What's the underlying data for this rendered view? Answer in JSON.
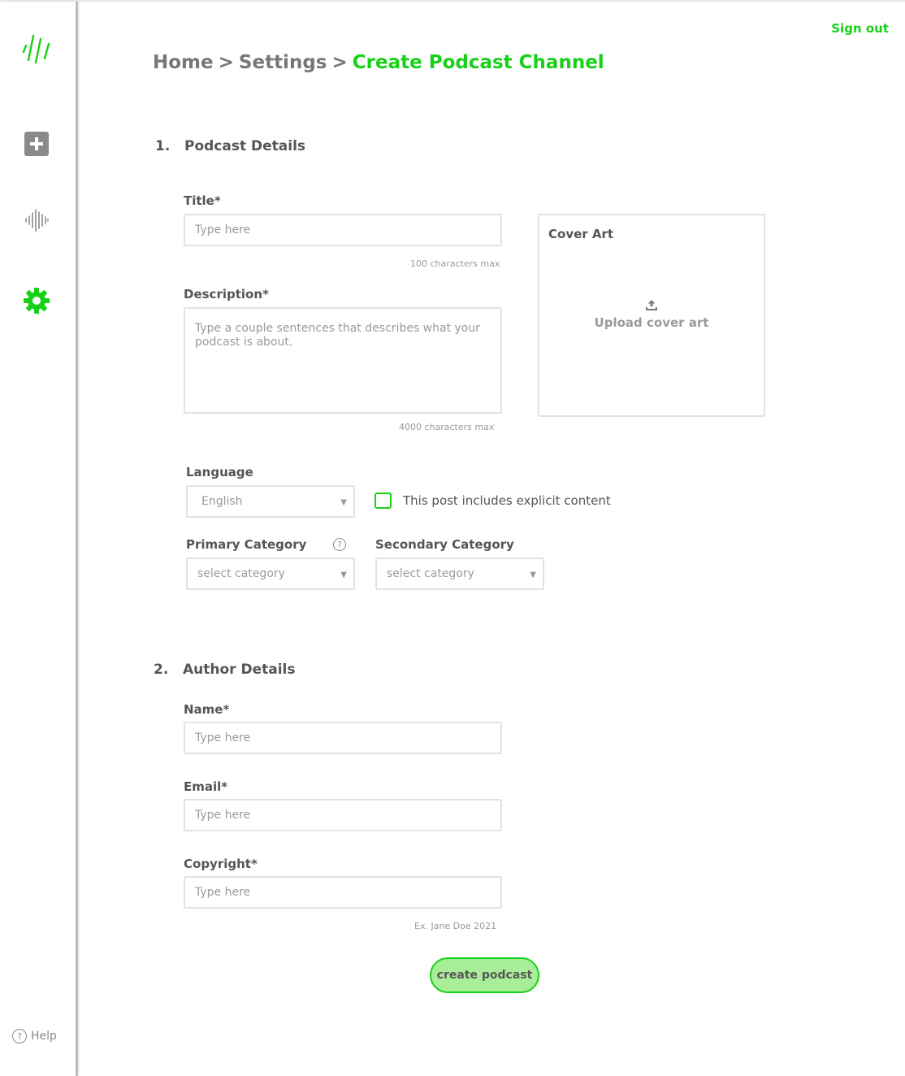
{
  "header": {
    "sign_out": "Sign out",
    "breadcrumb": {
      "home": "Home",
      "settings": "Settings",
      "separator": ">",
      "current": "Create Podcast Channel"
    }
  },
  "sidebar": {
    "icons": [
      "logo-icon",
      "plus-icon",
      "waveform-icon",
      "gear-icon"
    ],
    "help_label": "Help"
  },
  "colors": {
    "accent": "#17d117",
    "accent_light": "#a8ee99",
    "text": "#555555",
    "muted": "#9a9a9a",
    "border": "#e2e2e2"
  },
  "podcast_details": {
    "number": "1.",
    "title": "Podcast Details",
    "title_field": {
      "label": "Title*",
      "placeholder": "Type here",
      "hint": "100 characters max"
    },
    "description_field": {
      "label": "Description*",
      "placeholder": "Type a couple sentences that describes what your podcast is about.",
      "hint": "4000 characters max"
    },
    "cover_art": {
      "title": "Cover Art",
      "upload_label": "Upload cover art"
    },
    "language": {
      "label": "Language",
      "selected": "English"
    },
    "explicit_label": "This post includes explicit content",
    "primary_category": {
      "label": "Primary Category",
      "selected": "select category"
    },
    "secondary_category": {
      "label": "Secondary Category",
      "selected": "select category"
    }
  },
  "author_details": {
    "number": "2.",
    "title": "Author Details",
    "name_field": {
      "label": "Name*",
      "placeholder": "Type here"
    },
    "email_field": {
      "label": "Email*",
      "placeholder": "Type here"
    },
    "copyright_field": {
      "label": "Copyright*",
      "placeholder": "Type here",
      "hint": "Ex. Jane Doe 2021"
    }
  },
  "actions": {
    "create_label": "create podcast"
  }
}
